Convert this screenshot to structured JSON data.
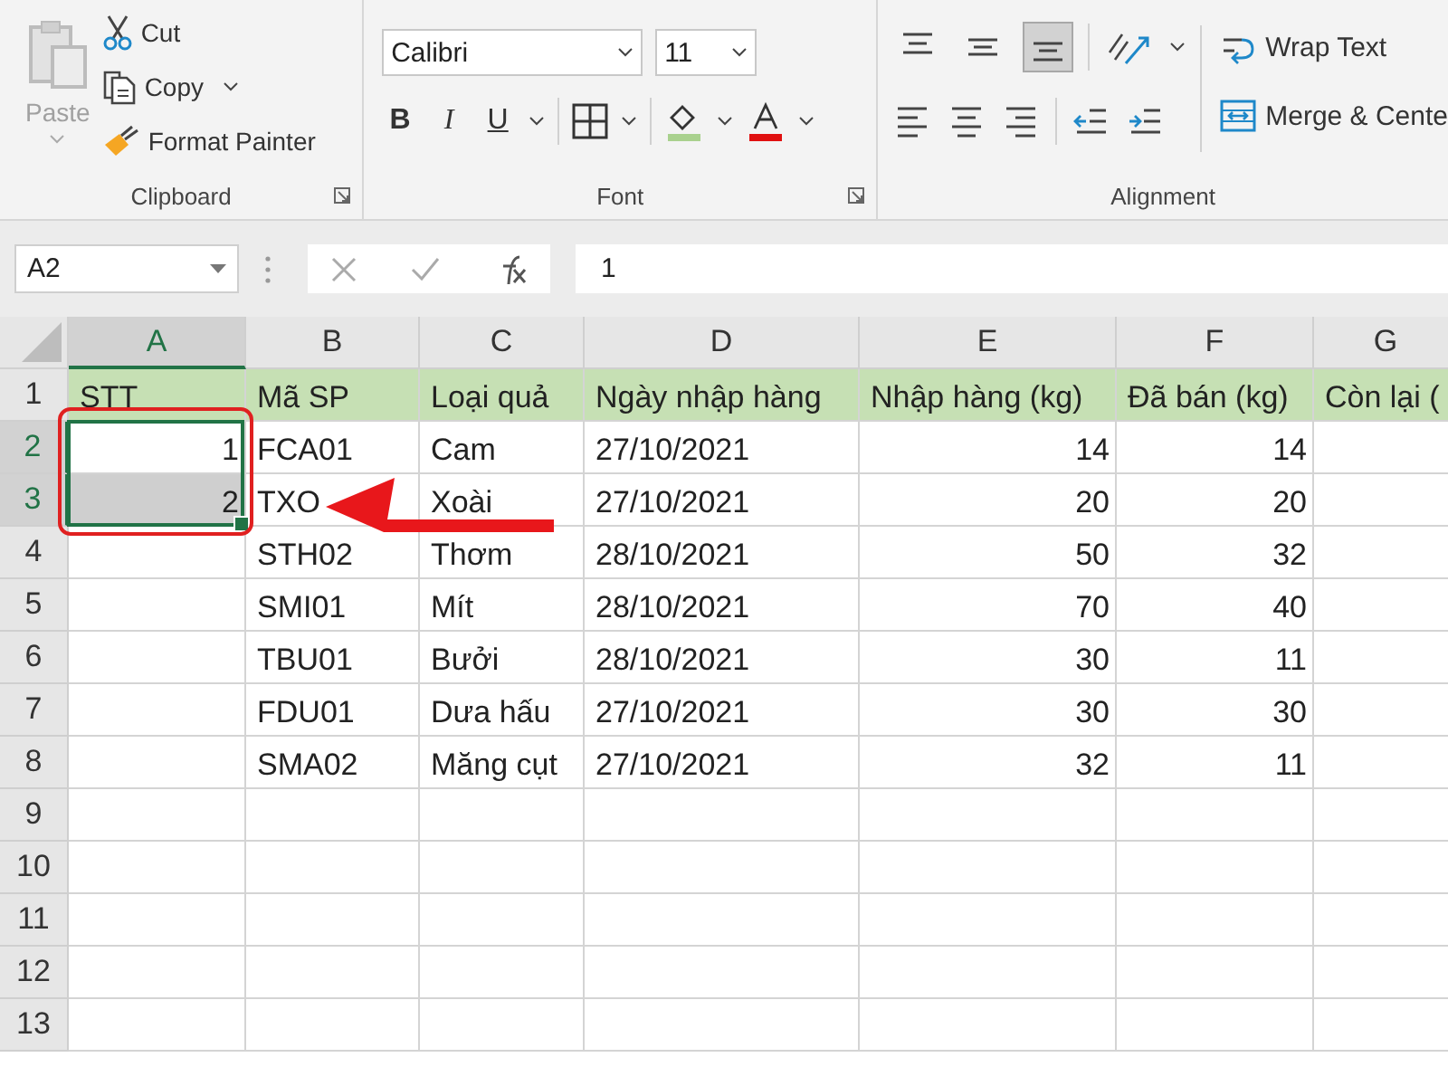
{
  "ribbon": {
    "clipboard": {
      "label": "Clipboard",
      "paste": {
        "label": "Paste",
        "disabled": true
      },
      "items": [
        {
          "kind": "cut",
          "label": "Cut"
        },
        {
          "kind": "copy",
          "label": "Copy"
        },
        {
          "kind": "painter",
          "label": "Format Painter"
        }
      ]
    },
    "font": {
      "label": "Font",
      "family": "Calibri",
      "size": "11",
      "styles": [
        {
          "kind": "bold",
          "label": "B"
        },
        {
          "kind": "italic",
          "label": "I"
        },
        {
          "kind": "underline",
          "label": "U"
        }
      ]
    },
    "alignment": {
      "label": "Alignment",
      "wrap": "Wrap Text",
      "merge": "Merge & Cente",
      "vertical": [
        {
          "kind": "top",
          "selected": false
        },
        {
          "kind": "middle",
          "selected": false
        },
        {
          "kind": "bottom",
          "selected": true
        }
      ]
    }
  },
  "formula_bar": {
    "name_box": "A2",
    "value": "1"
  },
  "sheet": {
    "columns": [
      {
        "label": "A",
        "selected": true
      },
      {
        "label": "B",
        "selected": false
      },
      {
        "label": "C",
        "selected": false
      },
      {
        "label": "D",
        "selected": false
      },
      {
        "label": "E",
        "selected": false
      },
      {
        "label": "F",
        "selected": false
      },
      {
        "label": "G",
        "selected": false
      }
    ],
    "rows": [
      {
        "number": "1",
        "kind": "header",
        "selected": false,
        "cells": [
          "STT",
          "Mã SP",
          "Loại quả",
          "Ngày nhập hàng",
          "Nhập hàng (kg)",
          "Đã bán (kg)",
          "Còn lại ("
        ]
      },
      {
        "number": "2",
        "kind": "data",
        "selected": true,
        "active": true,
        "stt": "1",
        "code": "FCA01",
        "fruit": "Cam",
        "date": "27/10/2021",
        "in": "14",
        "sold": "14"
      },
      {
        "number": "3",
        "kind": "data",
        "selected": true,
        "active": false,
        "stt": "2",
        "code": "TXO",
        "fruit": "Xoài",
        "date": "27/10/2021",
        "in": "20",
        "sold": "20"
      },
      {
        "number": "4",
        "kind": "data",
        "selected": false,
        "code": "STH02",
        "fruit": "Thơm",
        "date": "28/10/2021",
        "in": "50",
        "sold": "32"
      },
      {
        "number": "5",
        "kind": "data",
        "selected": false,
        "code": "SMI01",
        "fruit": "Mít",
        "date": "28/10/2021",
        "in": "70",
        "sold": "40"
      },
      {
        "number": "6",
        "kind": "data",
        "selected": false,
        "code": "TBU01",
        "fruit": "Bưởi",
        "date": "28/10/2021",
        "in": "30",
        "sold": "11"
      },
      {
        "number": "7",
        "kind": "data",
        "selected": false,
        "code": "FDU01",
        "fruit": "Dưa hấu",
        "date": "27/10/2021",
        "in": "30",
        "sold": "30"
      },
      {
        "number": "8",
        "kind": "data",
        "selected": false,
        "code": "SMA02",
        "fruit": "Măng cụt",
        "date": "27/10/2021",
        "in": "32",
        "sold": "11"
      },
      {
        "number": "9",
        "kind": "empty",
        "selected": false
      },
      {
        "number": "10",
        "kind": "empty",
        "selected": false
      },
      {
        "number": "11",
        "kind": "empty",
        "selected": false
      },
      {
        "number": "12",
        "kind": "empty",
        "selected": false
      },
      {
        "number": "13",
        "kind": "empty",
        "selected": false
      }
    ]
  }
}
